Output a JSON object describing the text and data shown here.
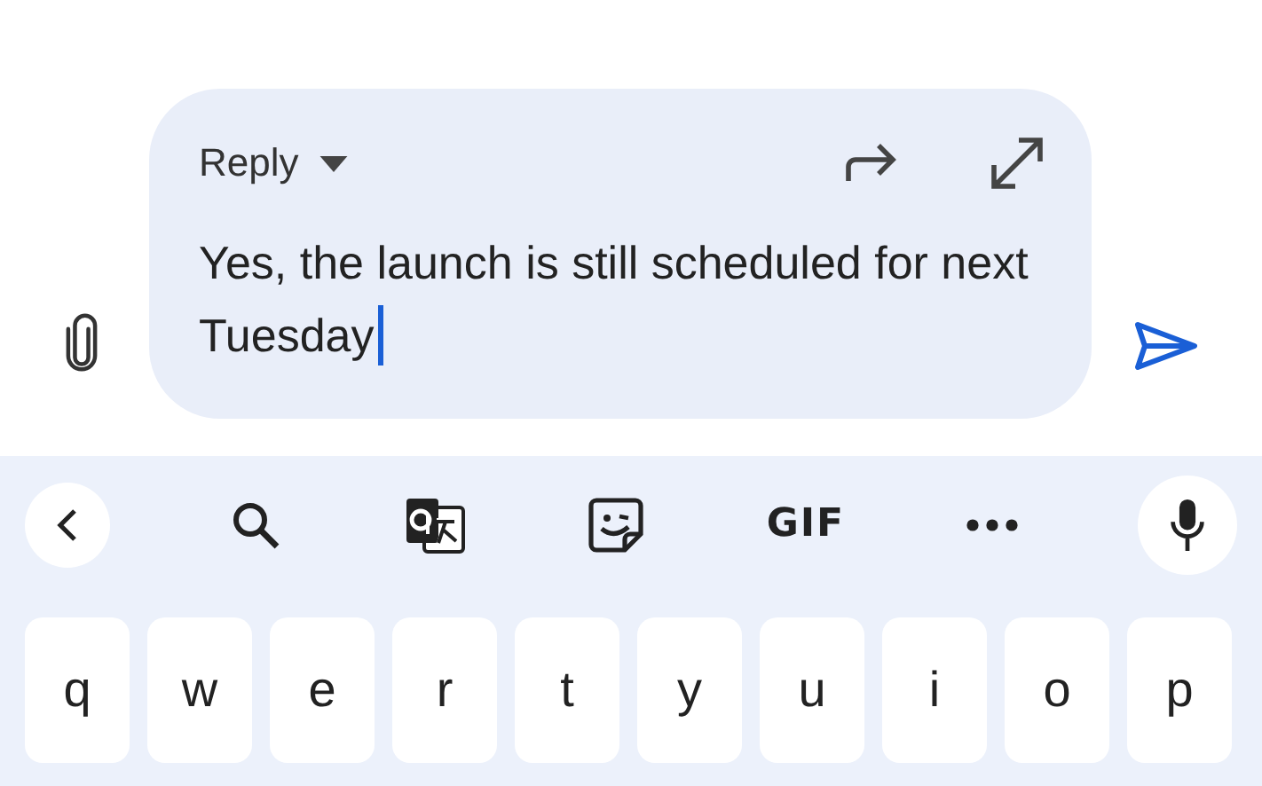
{
  "compose": {
    "mode_label": "Reply",
    "body": "Yes, the launch is still scheduled for next Tuesday"
  },
  "toolbar": {
    "gif_label": "GIF"
  },
  "keys": [
    "q",
    "w",
    "e",
    "r",
    "t",
    "y",
    "u",
    "i",
    "o",
    "p"
  ]
}
